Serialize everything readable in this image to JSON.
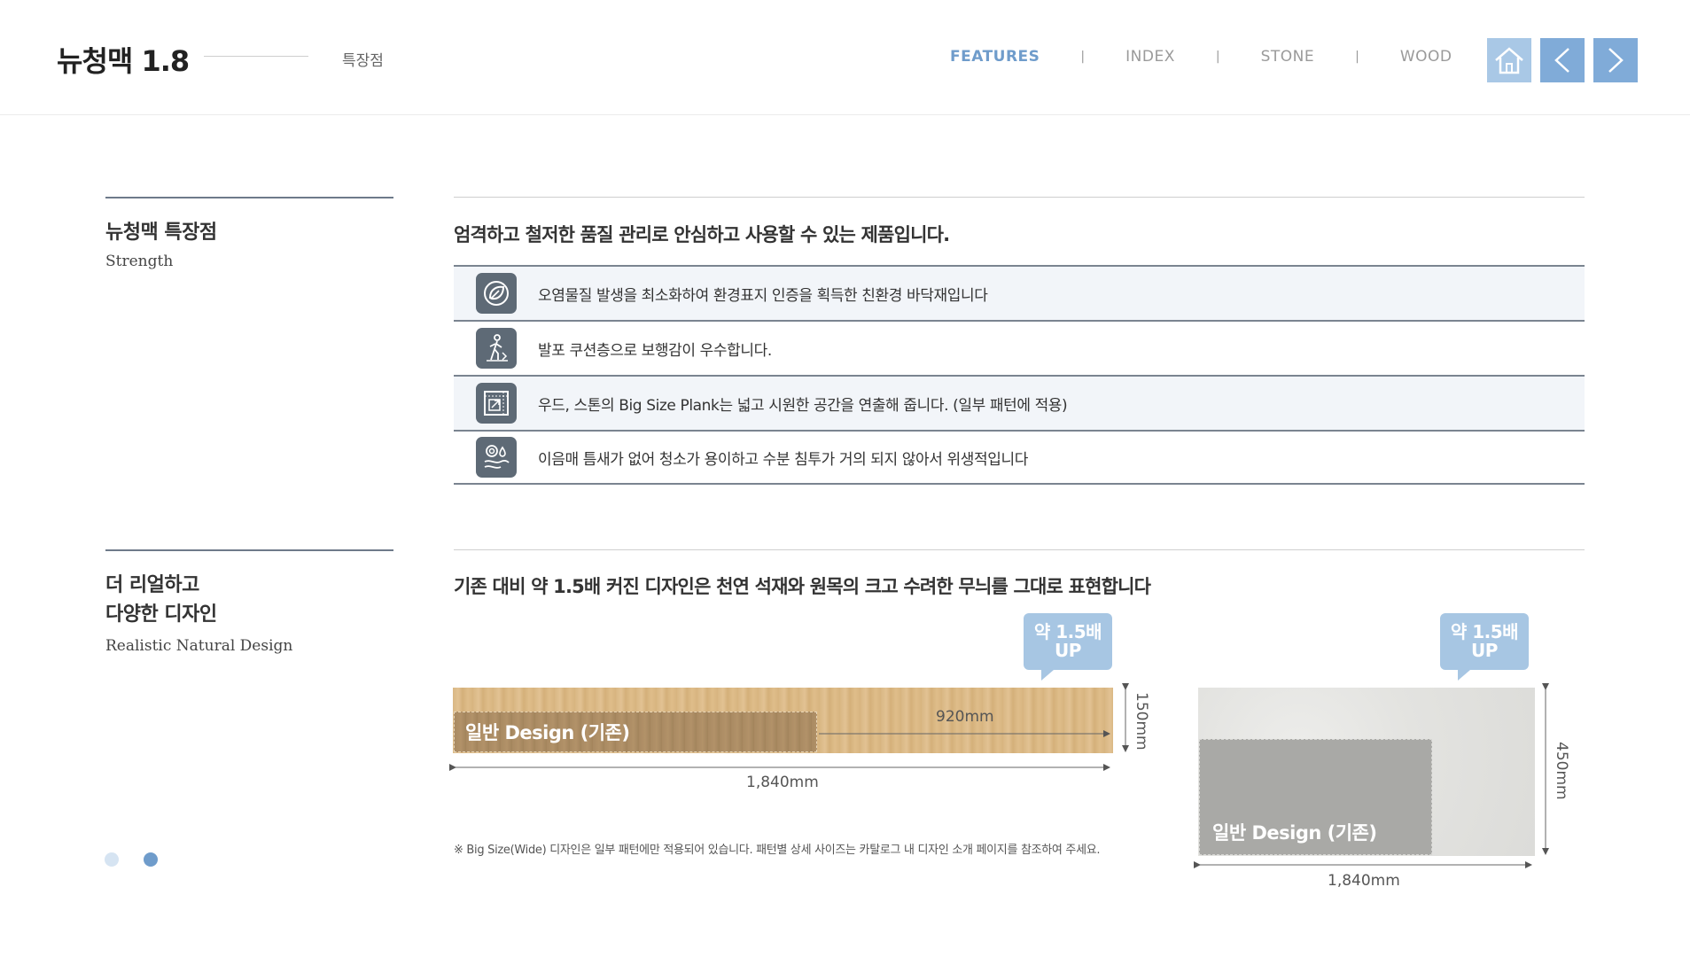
{
  "header": {
    "brand": "뉴청맥 1.8",
    "crumb": "특장점",
    "nav": [
      {
        "label": "FEATURES",
        "active": true
      },
      {
        "label": "INDEX",
        "active": false
      },
      {
        "label": "STONE",
        "active": false
      },
      {
        "label": "WOOD",
        "active": false
      }
    ],
    "separator": "|",
    "icons": {
      "home": "home-icon",
      "prev": "chevron-left-icon",
      "next": "chevron-right-icon"
    },
    "colors": {
      "accent": "#6f9ccb",
      "home_bg": "#a9c8e6",
      "arrow_bg": "#80abd8"
    }
  },
  "section1": {
    "title": "뉴청맥 특장점",
    "subtitle": "Strength",
    "heading": "엄격하고 철저한 품질 관리로 안심하고 사용할 수 있는 제품입니다.",
    "features": [
      {
        "icon": "leaf-icon",
        "text": "오염물질 발생을 최소화하여 환경표지 인증을 획득한 친환경 바닥재입니다"
      },
      {
        "icon": "walking-person-icon",
        "text": "발포 쿠션층으로 보행감이 우수합니다."
      },
      {
        "icon": "expand-area-icon",
        "text": "우드, 스톤의 Big Size Plank는 넓고 시원한 공간을 연출해 줍니다. (일부 패턴에 적용)"
      },
      {
        "icon": "water-drop-icon",
        "text": "이음매 틈새가 없어 청소가 용이하고 수분 침투가 거의 되지 않아서 위생적입니다"
      }
    ]
  },
  "section2": {
    "title_line1": "더 리얼하고",
    "title_line2": "다양한 디자인",
    "subtitle": "Realistic Natural Design",
    "heading": "기존 대비 약 1.5배 커진 디자인은 천연 석재와 원목의 크고 수려한 무늬를 그대로 표현합니다",
    "wood": {
      "badge_line1": "약 1.5배",
      "badge_line2": "UP",
      "label": "일반 Design (기존)",
      "inner_length": "920mm",
      "length": "1,840mm",
      "width": "150mm"
    },
    "stone": {
      "badge_line1": "약 1.5배",
      "badge_line2": "UP",
      "label": "일반 Design (기존)",
      "length": "1,840mm",
      "width": "450mm"
    },
    "note": "※ Big Size(Wide) 디자인은 일부 패턴에만 적용되어 있습니다. 패턴별 상세 사이즈는 카탈로그 내 디자인 소개 페이지를 참조하여 주세요."
  },
  "pagination": {
    "pages": 2,
    "current": 2
  }
}
